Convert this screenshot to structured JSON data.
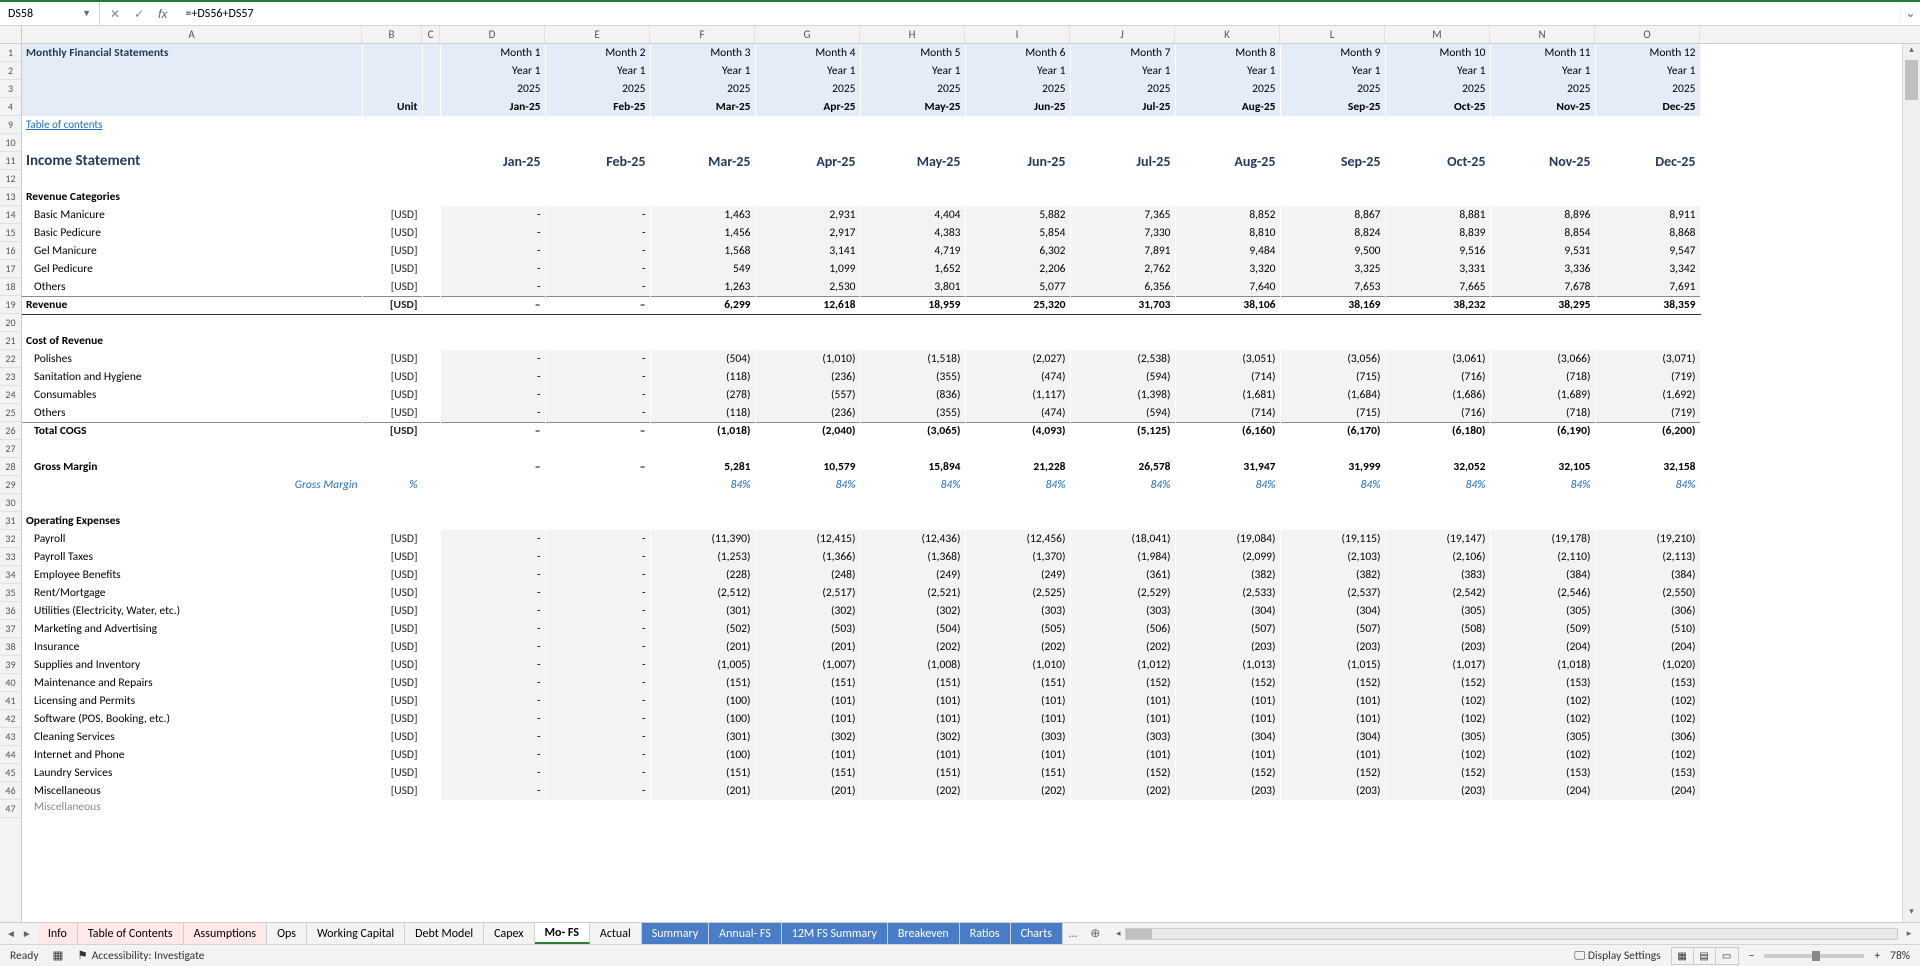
{
  "formula_bar": {
    "cell_ref": "DS58",
    "formula": "=+DS56+DS57"
  },
  "columns": [
    "A",
    "B",
    "C",
    "D",
    "E",
    "F",
    "G",
    "H",
    "I",
    "J",
    "K",
    "L",
    "M",
    "N",
    "O"
  ],
  "row_nums": [
    1,
    2,
    3,
    4,
    9,
    10,
    11,
    12,
    13,
    14,
    15,
    16,
    17,
    18,
    19,
    20,
    21,
    22,
    23,
    24,
    25,
    26,
    27,
    28,
    29,
    30,
    31,
    32,
    33,
    34,
    35,
    36,
    37,
    38,
    39,
    40,
    41,
    42,
    43,
    44,
    45,
    46,
    47
  ],
  "header": {
    "title": "Monthly Financial Statements",
    "unit_label": "Unit",
    "months_label": [
      "Month 1",
      "Month 2",
      "Month 3",
      "Month 4",
      "Month 5",
      "Month 6",
      "Month 7",
      "Month 8",
      "Month 9",
      "Month 10",
      "Month 11",
      "Month 12"
    ],
    "year_label": "Year 1",
    "year_num": "2025",
    "period_label": [
      "Jan-25",
      "Feb-25",
      "Mar-25",
      "Apr-25",
      "May-25",
      "Jun-25",
      "Jul-25",
      "Aug-25",
      "Sep-25",
      "Oct-25",
      "Nov-25",
      "Dec-25"
    ]
  },
  "toc": "Table of contents",
  "income": {
    "section": "Income Statement",
    "unit": "[USD]",
    "revenue_hdr": "Revenue Categories",
    "revenue_items": [
      {
        "label": "Basic Manicure",
        "v": [
          "-",
          "-",
          "1,463",
          "2,931",
          "4,404",
          "5,882",
          "7,365",
          "8,852",
          "8,867",
          "8,881",
          "8,896",
          "8,911"
        ]
      },
      {
        "label": "Basic Pedicure",
        "v": [
          "-",
          "-",
          "1,456",
          "2,917",
          "4,383",
          "5,854",
          "7,330",
          "8,810",
          "8,824",
          "8,839",
          "8,854",
          "8,868"
        ]
      },
      {
        "label": "Gel Manicure",
        "v": [
          "-",
          "-",
          "1,568",
          "3,141",
          "4,719",
          "6,302",
          "7,891",
          "9,484",
          "9,500",
          "9,516",
          "9,531",
          "9,547"
        ]
      },
      {
        "label": "Gel Pedicure",
        "v": [
          "-",
          "-",
          "549",
          "1,099",
          "1,652",
          "2,206",
          "2,762",
          "3,320",
          "3,325",
          "3,331",
          "3,336",
          "3,342"
        ]
      },
      {
        "label": "Others",
        "v": [
          "-",
          "-",
          "1,263",
          "2,530",
          "3,801",
          "5,077",
          "6,356",
          "7,640",
          "7,653",
          "7,665",
          "7,678",
          "7,691"
        ]
      }
    ],
    "revenue_total": {
      "label": "Revenue",
      "v": [
        "–",
        "–",
        "6,299",
        "12,618",
        "18,959",
        "25,320",
        "31,703",
        "38,106",
        "38,169",
        "38,232",
        "38,295",
        "38,359"
      ]
    },
    "cost_hdr": "Cost of Revenue",
    "cost_items": [
      {
        "label": "Polishes",
        "v": [
          "-",
          "-",
          "(504)",
          "(1,010)",
          "(1,518)",
          "(2,027)",
          "(2,538)",
          "(3,051)",
          "(3,056)",
          "(3,061)",
          "(3,066)",
          "(3,071)"
        ]
      },
      {
        "label": "Sanitation and Hygiene",
        "v": [
          "-",
          "-",
          "(118)",
          "(236)",
          "(355)",
          "(474)",
          "(594)",
          "(714)",
          "(715)",
          "(716)",
          "(718)",
          "(719)"
        ]
      },
      {
        "label": "Consumables",
        "v": [
          "-",
          "-",
          "(278)",
          "(557)",
          "(836)",
          "(1,117)",
          "(1,398)",
          "(1,681)",
          "(1,684)",
          "(1,686)",
          "(1,689)",
          "(1,692)"
        ]
      },
      {
        "label": "Others",
        "v": [
          "-",
          "-",
          "(118)",
          "(236)",
          "(355)",
          "(474)",
          "(594)",
          "(714)",
          "(715)",
          "(716)",
          "(718)",
          "(719)"
        ]
      }
    ],
    "cogs_total": {
      "label": "Total COGS",
      "v": [
        "–",
        "–",
        "(1,018)",
        "(2,040)",
        "(3,065)",
        "(4,093)",
        "(5,125)",
        "(6,160)",
        "(6,170)",
        "(6,180)",
        "(6,190)",
        "(6,200)"
      ]
    },
    "gross_margin": {
      "label": "Gross Margin",
      "v": [
        "–",
        "–",
        "5,281",
        "10,579",
        "15,894",
        "21,228",
        "26,578",
        "31,947",
        "31,999",
        "32,052",
        "32,105",
        "32,158"
      ]
    },
    "gm_pct": {
      "label": "Gross Margin",
      "unit": "%",
      "v": [
        "",
        "",
        "84%",
        "84%",
        "84%",
        "84%",
        "84%",
        "84%",
        "84%",
        "84%",
        "84%",
        "84%"
      ]
    },
    "opex_hdr": "Operating Expenses",
    "opex_items": [
      {
        "label": "Payroll",
        "v": [
          "-",
          "-",
          "(11,390)",
          "(12,415)",
          "(12,436)",
          "(12,456)",
          "(18,041)",
          "(19,084)",
          "(19,115)",
          "(19,147)",
          "(19,178)",
          "(19,210)"
        ]
      },
      {
        "label": "Payroll Taxes",
        "v": [
          "-",
          "-",
          "(1,253)",
          "(1,366)",
          "(1,368)",
          "(1,370)",
          "(1,984)",
          "(2,099)",
          "(2,103)",
          "(2,106)",
          "(2,110)",
          "(2,113)"
        ]
      },
      {
        "label": "Employee Benefits",
        "v": [
          "-",
          "-",
          "(228)",
          "(248)",
          "(249)",
          "(249)",
          "(361)",
          "(382)",
          "(382)",
          "(383)",
          "(384)",
          "(384)"
        ]
      },
      {
        "label": "Rent/Mortgage",
        "v": [
          "-",
          "-",
          "(2,512)",
          "(2,517)",
          "(2,521)",
          "(2,525)",
          "(2,529)",
          "(2,533)",
          "(2,537)",
          "(2,542)",
          "(2,546)",
          "(2,550)"
        ]
      },
      {
        "label": "Utilities (Electricity, Water, etc.)",
        "v": [
          "-",
          "-",
          "(301)",
          "(302)",
          "(302)",
          "(303)",
          "(303)",
          "(304)",
          "(304)",
          "(305)",
          "(305)",
          "(306)"
        ]
      },
      {
        "label": "Marketing and Advertising",
        "v": [
          "-",
          "-",
          "(502)",
          "(503)",
          "(504)",
          "(505)",
          "(506)",
          "(507)",
          "(507)",
          "(508)",
          "(509)",
          "(510)"
        ]
      },
      {
        "label": "Insurance",
        "v": [
          "-",
          "-",
          "(201)",
          "(201)",
          "(202)",
          "(202)",
          "(202)",
          "(203)",
          "(203)",
          "(203)",
          "(204)",
          "(204)"
        ]
      },
      {
        "label": "Supplies and Inventory",
        "v": [
          "-",
          "-",
          "(1,005)",
          "(1,007)",
          "(1,008)",
          "(1,010)",
          "(1,012)",
          "(1,013)",
          "(1,015)",
          "(1,017)",
          "(1,018)",
          "(1,020)"
        ]
      },
      {
        "label": "Maintenance and Repairs",
        "v": [
          "-",
          "-",
          "(151)",
          "(151)",
          "(151)",
          "(151)",
          "(152)",
          "(152)",
          "(152)",
          "(152)",
          "(153)",
          "(153)"
        ]
      },
      {
        "label": "Licensing and Permits",
        "v": [
          "-",
          "-",
          "(100)",
          "(101)",
          "(101)",
          "(101)",
          "(101)",
          "(101)",
          "(101)",
          "(102)",
          "(102)",
          "(102)"
        ]
      },
      {
        "label": "Software (POS, Booking, etc.)",
        "v": [
          "-",
          "-",
          "(100)",
          "(101)",
          "(101)",
          "(101)",
          "(101)",
          "(101)",
          "(101)",
          "(102)",
          "(102)",
          "(102)"
        ]
      },
      {
        "label": "Cleaning Services",
        "v": [
          "-",
          "-",
          "(301)",
          "(302)",
          "(302)",
          "(303)",
          "(303)",
          "(304)",
          "(304)",
          "(305)",
          "(305)",
          "(306)"
        ]
      },
      {
        "label": "Internet and Phone",
        "v": [
          "-",
          "-",
          "(100)",
          "(101)",
          "(101)",
          "(101)",
          "(101)",
          "(101)",
          "(101)",
          "(102)",
          "(102)",
          "(102)"
        ]
      },
      {
        "label": "Laundry Services",
        "v": [
          "-",
          "-",
          "(151)",
          "(151)",
          "(151)",
          "(151)",
          "(152)",
          "(152)",
          "(152)",
          "(152)",
          "(153)",
          "(153)"
        ]
      },
      {
        "label": "Miscellaneous",
        "v": [
          "-",
          "-",
          "(201)",
          "(201)",
          "(202)",
          "(202)",
          "(202)",
          "(203)",
          "(203)",
          "(203)",
          "(204)",
          "(204)"
        ]
      },
      {
        "label": "Miscellaneous",
        "v": [
          "",
          "",
          "",
          "",
          "",
          "",
          "",
          "",
          "",
          "",
          "",
          ""
        ]
      }
    ]
  },
  "tabs": [
    "Info",
    "Table of Contents",
    "Assumptions",
    "Ops",
    "Working Capital",
    "Debt Model",
    "Capex",
    "Mo- FS",
    "Actual",
    "Summary",
    "Annual- FS",
    "12M FS Summary",
    "Breakeven",
    "Ratios",
    "Charts"
  ],
  "active_tab": "Mo- FS",
  "pink_tabs": [
    "Info",
    "Table of Contents",
    "Assumptions"
  ],
  "blue_tabs": [
    "Summary",
    "Annual- FS",
    "12M FS Summary",
    "Breakeven",
    "Ratios",
    "Charts"
  ],
  "status": {
    "ready": "Ready",
    "accessibility": "Accessibility: Investigate",
    "display": "Display Settings",
    "zoom": "78%"
  }
}
